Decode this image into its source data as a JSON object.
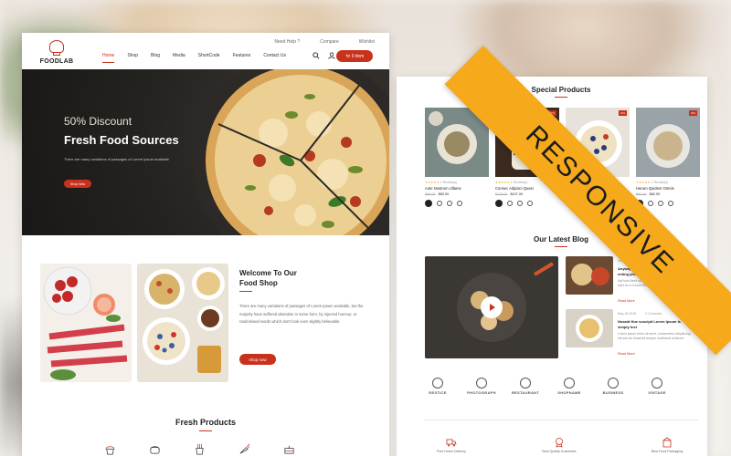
{
  "left_page": {
    "topbar": [
      "Need Help ?",
      "Compare",
      "Wishlist"
    ],
    "logo": "FOODLAB",
    "nav": [
      "Home",
      "Shop",
      "Blog",
      "Media",
      "ShortCode",
      "Features",
      "Contact Us"
    ],
    "cart_label": "0 item",
    "hero": {
      "discount": "50% Discount",
      "title": "Fresh Food Sources",
      "desc": "There are many variations of passages of Lorem Ipsum available",
      "button": "Shop Now"
    },
    "welcome": {
      "title_line1": "Welcome To Our",
      "title_line2": "Food Shop",
      "text": "There are many variations of passages of Lorem Ipsum available, but the majority have suffered alteration in some form, by injected humour, or randomised words which don't look even slightly believable.",
      "button": "shop now"
    },
    "fresh_title": "Fresh Products",
    "fresh_icons": [
      "cupcake-icon",
      "bread-icon",
      "fries-icon",
      "carrot-icon",
      "cake-icon"
    ]
  },
  "right_page": {
    "special_title": "Special Products",
    "products": [
      {
        "name": "Aute Nostrum Ullame",
        "old_price": "$96.00",
        "price": "$82.00",
        "reviews": "1 Review(s)",
        "tag": "-5%"
      },
      {
        "name": "Consec Adipisci Quasi",
        "old_price": "$115.00",
        "price": "$107.00",
        "reviews": "1 Review(s)",
        "tag": "-7%"
      },
      {
        "name": "Deniread Minima Veniam",
        "old_price": "$92.00",
        "price": "$86.00",
        "reviews": "1 Review(s)",
        "tag": "-6%"
      },
      {
        "name": "Harum Quidem Omnis",
        "old_price": "$90.00",
        "price": "$82.00",
        "reviews": "1 Review(s)",
        "tag": "-8%"
      }
    ],
    "blog_title": "Our Latest Blog",
    "blog_posts": [
      {
        "date": "Jan 18,2018",
        "comments": "0 Comment",
        "title": "Anyway 80PE is a NYC agency reprer enting photographers",
        "text": "Vat food fixed outfits placed by Phyllis Santo Buses start for a Couch Pete collaboration with the ...",
        "more": "Read More"
      },
      {
        "date": "May 18,2018",
        "comments": "0 Comment",
        "title": "Nosaid Hue suscipit Lorem Ipsum is simply text",
        "text": "Lorem ipsum dolor sit amet, consectetur adipisicing elit sed do eiusmod tempor incididunt ut labore",
        "more": "Read More"
      }
    ],
    "brands": [
      "RESTICE",
      "PHOTOGRAPH",
      "RESTAURANT",
      "SHOPNAME",
      "BUSINESS",
      "VINTAGE"
    ],
    "services": [
      "Free Home Delivery",
      "Best Quality Guarantee",
      "Best Food Packaging"
    ]
  },
  "ribbon": "RESPONSIVE",
  "colors": {
    "accent": "#c8321c",
    "ribbon": "#f6a91b",
    "star": "#f2b01e"
  }
}
